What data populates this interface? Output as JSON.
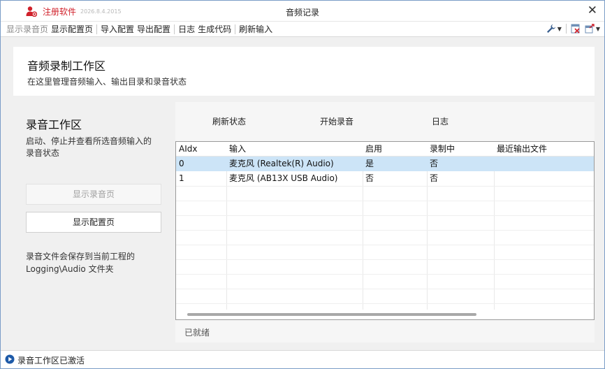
{
  "app": {
    "brand": "注册软件",
    "version": "2026.8.4.2015",
    "title": "音频记录",
    "close": "✕"
  },
  "menu": {
    "items": [
      "显示录音页",
      "显示配置页",
      "导入配置",
      "导出配置",
      "日志",
      "生成代码",
      "刷新输入"
    ]
  },
  "header": {
    "title": "音频录制工作区",
    "subtitle": "在这里管理音频输入、输出目录和录音状态"
  },
  "left": {
    "title": "录音工作区",
    "description": "启动、停止并查看所选音频输入的录音状态",
    "buttons": {
      "show_record": "显示录音页",
      "show_config": "显示配置页"
    },
    "note": "录音文件会保存到当前工程的 Logging\\Audio 文件夹"
  },
  "actions": {
    "refresh": "刷新状态",
    "start": "开始录音",
    "log": "日志"
  },
  "table": {
    "columns": [
      "AIdx",
      "输入",
      "启用",
      "录制中",
      "最近输出文件"
    ],
    "rows": [
      [
        "0",
        "麦克风 (Realtek(R) Audio)",
        "是",
        "否",
        ""
      ],
      [
        "1",
        "麦克风 (AB13X USB Audio)",
        "否",
        "否",
        ""
      ]
    ],
    "selected_row": 0
  },
  "panel_status": "已就绪",
  "statusbar": {
    "message": "录音工作区已激活"
  },
  "colors": {
    "brand": "#d0202a",
    "selection": "#cce4f7",
    "status_icon": "#1e5aa8"
  }
}
